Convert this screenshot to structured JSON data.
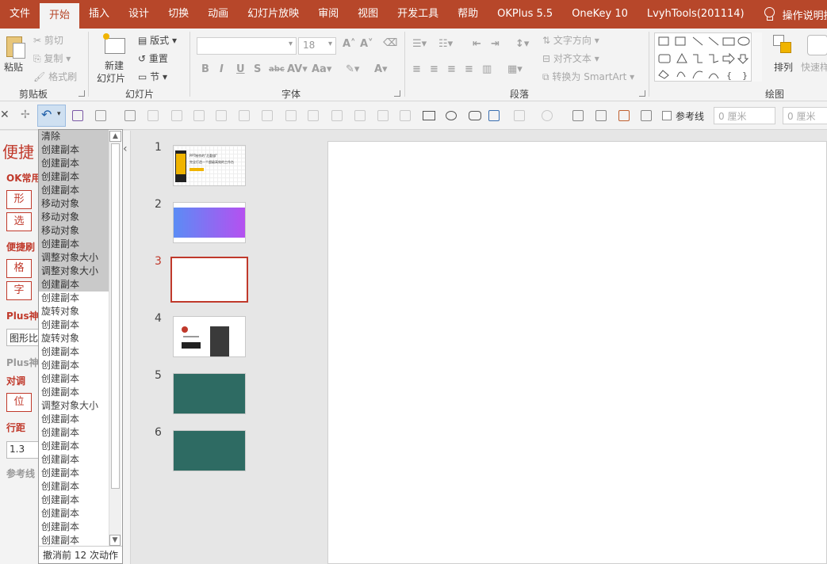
{
  "tabs": [
    "文件",
    "开始",
    "插入",
    "设计",
    "切换",
    "动画",
    "幻灯片放映",
    "审阅",
    "视图",
    "开发工具",
    "帮助",
    "OKPlus 5.5",
    "OneKey 10",
    "LvyhTools(201114)"
  ],
  "active_tab": "开始",
  "tell_me": "操作说明搜索",
  "ribbon": {
    "clipboard": {
      "paste": "粘贴",
      "cut": "剪切",
      "copy": "复制",
      "format_painter": "格式刷",
      "label": "剪贴板"
    },
    "slides": {
      "new_slide_line1": "新建",
      "new_slide_line2": "幻灯片",
      "layout": "版式",
      "reset": "重置",
      "section": "节",
      "label": "幻灯片"
    },
    "font": {
      "font_size": "18",
      "label": "字体"
    },
    "paragraph": {
      "text_direction": "文字方向",
      "align_text": "对齐文本",
      "smartart": "转换为 SmartArt",
      "label": "段落"
    },
    "drawing": {
      "arrange": "排列",
      "quick_styles": "快速样",
      "label": "绘图"
    }
  },
  "toolbar": {
    "guides_label": "参考线",
    "width_value": "0 厘米",
    "height_value": "0 厘米"
  },
  "left_pane": {
    "title": "便捷",
    "h1": "OK常用",
    "btn1": "形",
    "btn2": "选",
    "h2": "便捷刷",
    "btn3": "格",
    "btn4": "字",
    "h3": "Plus神",
    "input1": "图形比",
    "h4": "Plus神",
    "h5": "对调",
    "btn5": "位",
    "h6": "行距",
    "input2": "1.3",
    "h7": "参考线"
  },
  "undo_list": {
    "items": [
      "清除",
      "创建副本",
      "创建副本",
      "创建副本",
      "创建副本",
      "移动对象",
      "移动对象",
      "移动对象",
      "创建副本",
      "调整对象大小",
      "调整对象大小",
      "创建副本",
      "创建副本",
      "旋转对象",
      "创建副本",
      "旋转对象",
      "创建副本",
      "创建副本",
      "创建副本",
      "创建副本",
      "调整对象大小",
      "创建副本",
      "创建副本",
      "创建副本",
      "创建副本",
      "创建副本",
      "创建副本",
      "创建副本",
      "创建副本",
      "创建副本",
      "创建副本"
    ],
    "selected_count": 12,
    "footer": "撤消前 12 次动作"
  },
  "slides": {
    "numbers": [
      "1",
      "2",
      "3",
      "4",
      "5",
      "6"
    ],
    "current": 3,
    "thumb1_line1": "PPT制作的“后勤部”",
    "thumb1_line2": "完全打造一个超级高效的工作台",
    "colors": {
      "teal": "#2e6b63",
      "gradient_start": "#5b8cf5",
      "gradient_end": "#b74ff0",
      "accent": "#b7472a"
    }
  }
}
